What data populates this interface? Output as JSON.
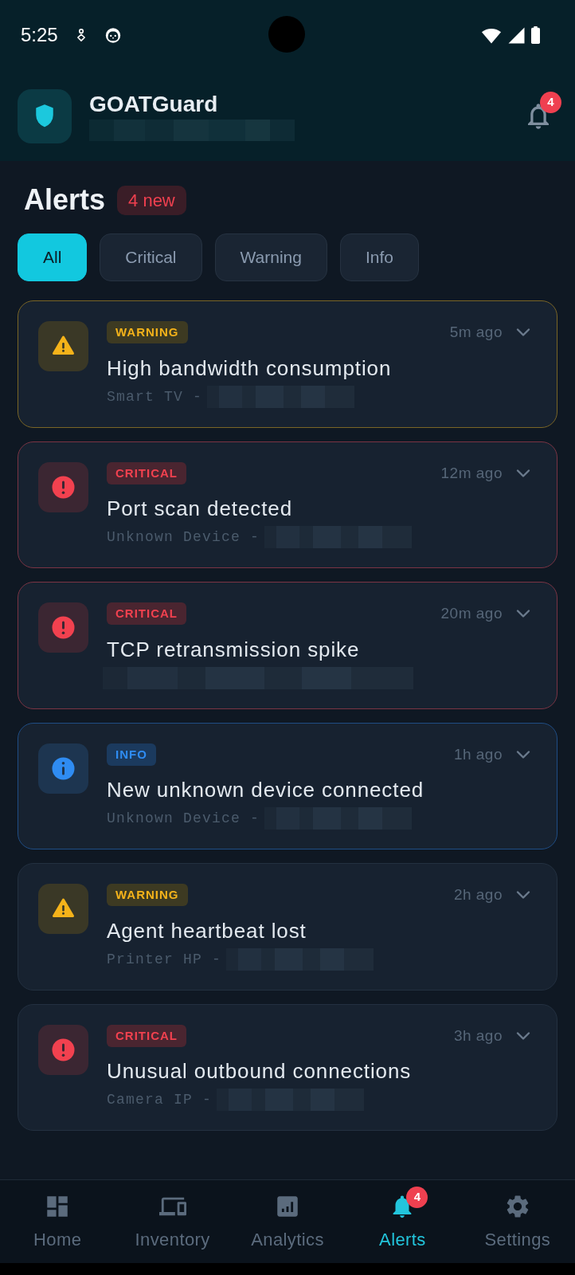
{
  "status_bar": {
    "time": "5:25"
  },
  "app_bar": {
    "title": "GOATGuard",
    "subtitle_blurred": true,
    "notification_badge": "4"
  },
  "page": {
    "title": "Alerts",
    "new_badge": "4 new"
  },
  "filters": [
    {
      "label": "All",
      "selected": true
    },
    {
      "label": "Critical",
      "selected": false
    },
    {
      "label": "Warning",
      "selected": false
    },
    {
      "label": "Info",
      "selected": false
    }
  ],
  "alerts": [
    {
      "kind": "warning",
      "tag": "WARNING",
      "time": "5m ago",
      "title": "High bandwidth consumption",
      "device": "Smart TV -",
      "detail_blurred": true,
      "unread": true,
      "expanded": false
    },
    {
      "kind": "critical",
      "tag": "CRITICAL",
      "time": "12m ago",
      "title": "Port scan detected",
      "device": "Unknown Device -",
      "detail_blurred": true,
      "unread": true,
      "expanded": false
    },
    {
      "kind": "critical",
      "tag": "CRITICAL",
      "time": "20m ago",
      "title": "TCP retransmission spike",
      "detail_blurred": true,
      "unread": true,
      "expanded": false
    },
    {
      "kind": "info",
      "tag": "INFO",
      "time": "1h ago",
      "title": "New unknown device connected",
      "device": "Unknown Device -",
      "detail_blurred": true,
      "unread": true,
      "expanded": false
    },
    {
      "kind": "warning",
      "tag": "WARNING",
      "time": "2h ago",
      "title": "Agent heartbeat lost",
      "device": "Printer HP -",
      "detail_blurred": true,
      "unread": false,
      "expanded": false
    },
    {
      "kind": "critical",
      "tag": "CRITICAL",
      "time": "3h ago",
      "title": "Unusual outbound connections",
      "device": "Camera IP -",
      "detail_blurred": true,
      "unread": false,
      "expanded": false
    }
  ],
  "bottom_nav": [
    {
      "label": "Home",
      "kind": "dashboard",
      "selected": false
    },
    {
      "label": "Inventory",
      "kind": "devices",
      "selected": false
    },
    {
      "label": "Analytics",
      "kind": "analytics",
      "selected": false
    },
    {
      "label": "Alerts",
      "kind": "bell",
      "selected": true,
      "badge": "4"
    },
    {
      "label": "Settings",
      "kind": "gear",
      "selected": false
    }
  ]
}
